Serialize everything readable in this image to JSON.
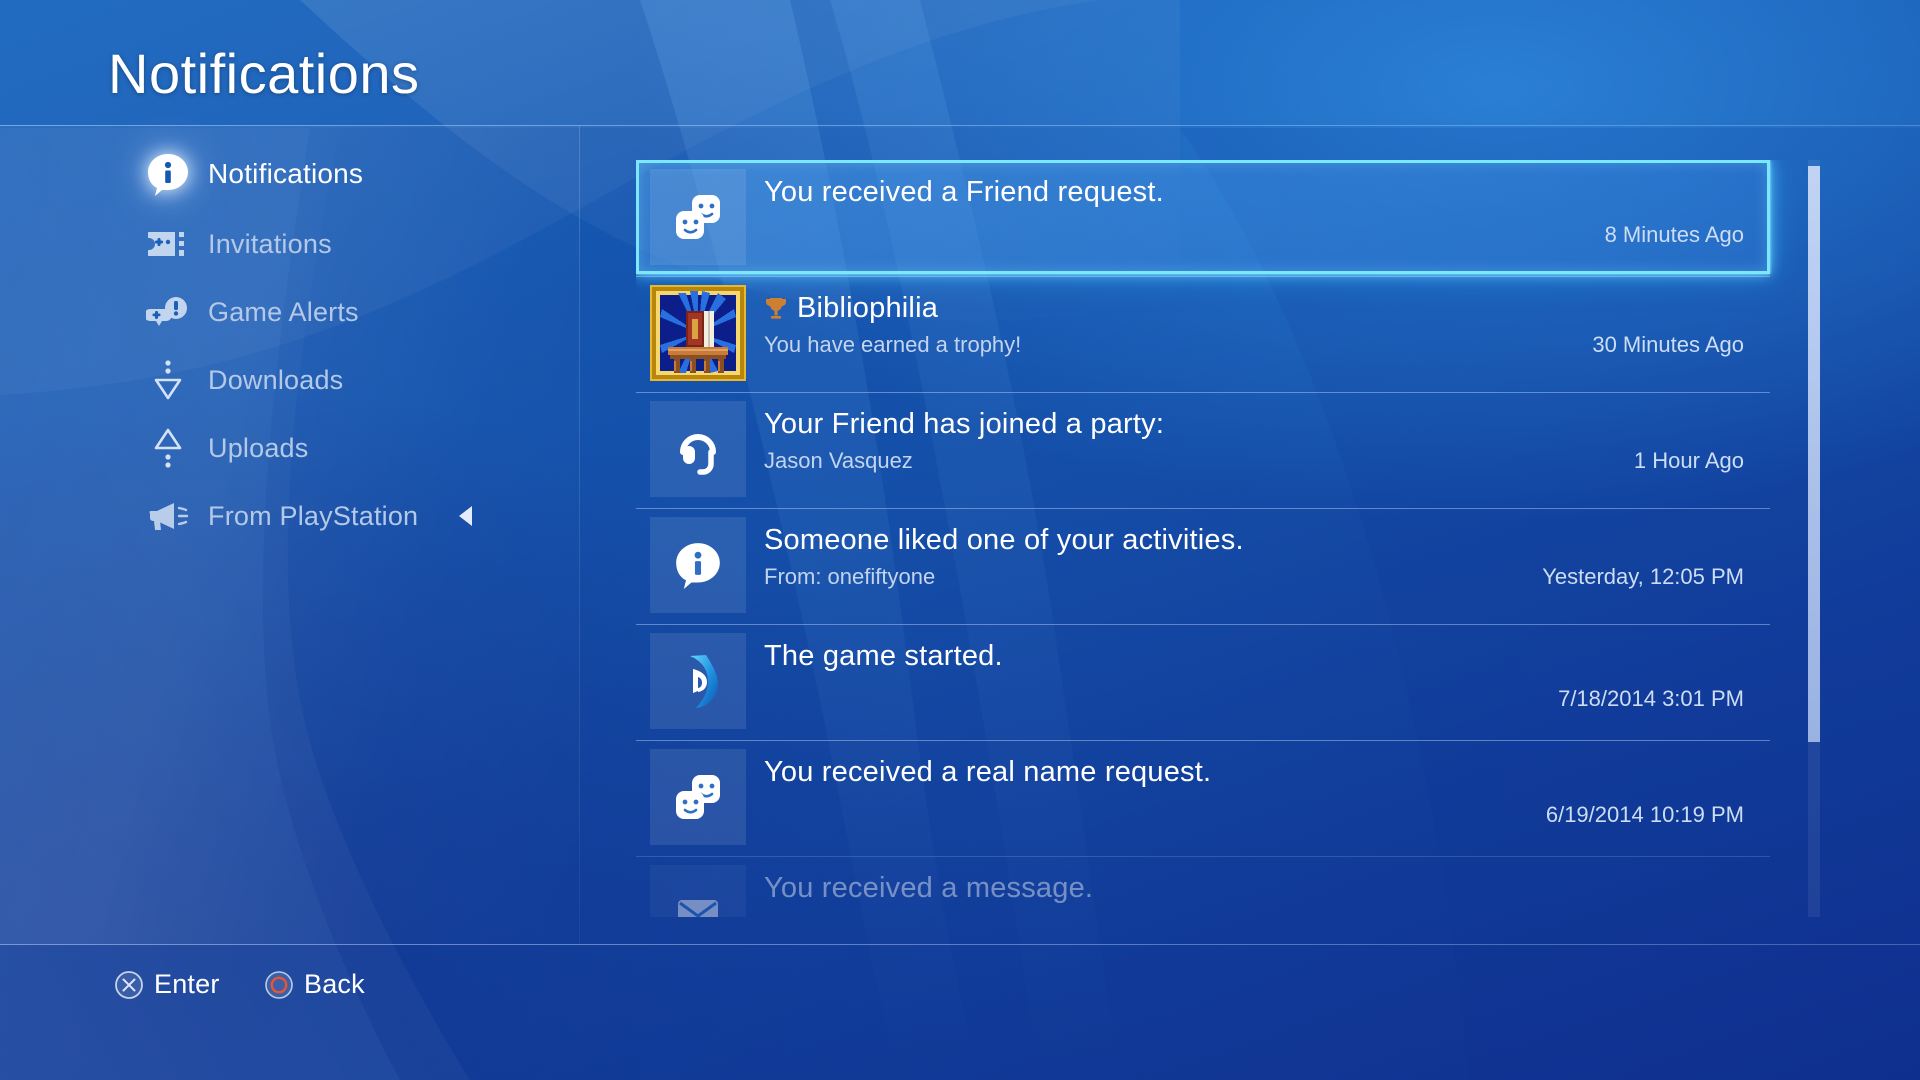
{
  "header": {
    "title": "Notifications"
  },
  "sidebar": {
    "items": [
      {
        "label": "Notifications",
        "icon": "info-bubble-icon",
        "active": true,
        "arrow": false
      },
      {
        "label": "Invitations",
        "icon": "ticket-controller-icon",
        "active": false,
        "arrow": false
      },
      {
        "label": "Game Alerts",
        "icon": "controller-alert-icon",
        "active": false,
        "arrow": false
      },
      {
        "label": "Downloads",
        "icon": "download-arrow-icon",
        "active": false,
        "arrow": false
      },
      {
        "label": "Uploads",
        "icon": "upload-arrow-icon",
        "active": false,
        "arrow": false
      },
      {
        "label": "From PlayStation",
        "icon": "megaphone-icon",
        "active": false,
        "arrow": true
      }
    ]
  },
  "notifications": {
    "items": [
      {
        "icon": "friends-faces-icon",
        "title": "You received a Friend request.",
        "subtitle": "",
        "time": "8 Minutes Ago",
        "selected": true,
        "trophy": false,
        "faded": false
      },
      {
        "icon": "trophy-thumbnail",
        "title": "Bibliophilia",
        "subtitle": "You have earned a trophy!",
        "time": "30 Minutes Ago",
        "selected": false,
        "trophy": true,
        "faded": false
      },
      {
        "icon": "headset-icon",
        "title": "Your Friend has joined a party:",
        "subtitle": "Jason Vasquez",
        "time": "1 Hour Ago",
        "selected": false,
        "trophy": false,
        "faded": false
      },
      {
        "icon": "info-bubble-icon",
        "title": "Someone liked one of your activities.",
        "subtitle": "From: onefiftyone",
        "time": "Yesterday, 12:05 PM",
        "selected": false,
        "trophy": false,
        "faded": false
      },
      {
        "icon": "playstation-logo-icon",
        "title": "The game started.",
        "subtitle": "",
        "time": "7/18/2014   3:01 PM",
        "selected": false,
        "trophy": false,
        "faded": false
      },
      {
        "icon": "friends-faces-icon",
        "title": "You received a real name request.",
        "subtitle": "",
        "time": "6/19/2014   10:19 PM",
        "selected": false,
        "trophy": false,
        "faded": false
      },
      {
        "icon": "message-icon",
        "title": "You received a message.",
        "subtitle": "",
        "time": "",
        "selected": false,
        "trophy": false,
        "faded": true
      }
    ]
  },
  "footer": {
    "hints": [
      {
        "button": "cross-button-icon",
        "label": "Enter"
      },
      {
        "button": "circle-button-icon",
        "label": "Back"
      }
    ]
  },
  "colors": {
    "selection_glow": "#7ce8ff",
    "background_blue": "#1559b4",
    "accent_text": "#ffffff",
    "muted_text": "#b4c9e8",
    "circle_button": "#e8552e",
    "trophy_bronze": "#cd7f32"
  }
}
